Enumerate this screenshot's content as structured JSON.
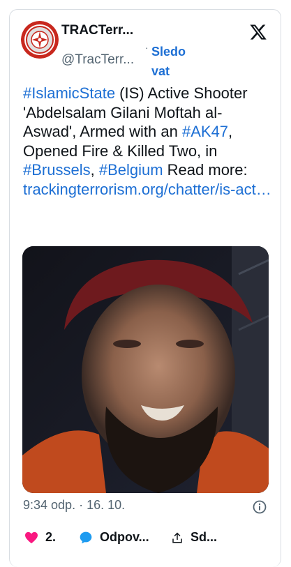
{
  "account": {
    "display_name": "TRACTerr...",
    "handle": "@TracTerr...",
    "separator": "·",
    "follow_line1": "Sledo",
    "follow_line2": "vat"
  },
  "tweet": {
    "text_parts": [
      {
        "text": "#IslamicState",
        "type": "tag"
      },
      {
        "text": " (IS) Active Shooter 'Abdelsalam Gilani Moftah al-Aswad', Armed with an ",
        "type": "text"
      },
      {
        "text": "#AK47",
        "type": "tag"
      },
      {
        "text": ", Opened Fire & Killed Two, in ",
        "type": "text"
      },
      {
        "text": "#Brussels",
        "type": "tag"
      },
      {
        "text": ", ",
        "type": "text"
      },
      {
        "text": "#Belgium",
        "type": "tag"
      },
      {
        "text": " Read more: ",
        "type": "text"
      },
      {
        "text": "trackingterrorism.org/chatter/is-act…",
        "type": "link"
      }
    ],
    "timestamp": "9:34 odp. · 16. 10."
  },
  "actions": {
    "likes": "2.",
    "reply_label": "Odpov...",
    "share_label": "Sd..."
  },
  "colors": {
    "link": "#1d6fd4",
    "like": "#f91880",
    "reply": "#1d9bf0",
    "muted": "#536471"
  },
  "icons": [
    "tractr-logo",
    "x-logo-icon",
    "info-icon",
    "heart-icon",
    "reply-bubble-icon",
    "share-icon"
  ]
}
